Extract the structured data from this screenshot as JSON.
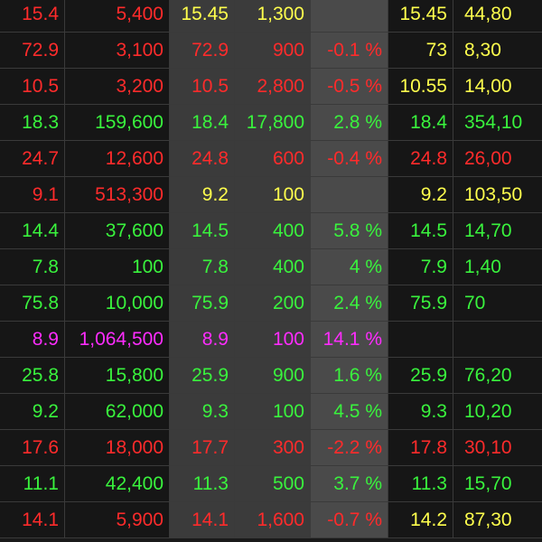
{
  "colors": {
    "down": "#ff2b2b",
    "up": "#39f33d",
    "reference": "#ffff4d",
    "ceiling": "#ff2cff",
    "dark_cell": "#161616",
    "grey_cell": "#3b3b3b",
    "light_grey_cell": "#4a4a4a"
  },
  "rows": [
    {
      "c1": "15.4",
      "c2": "5,400",
      "c3": "15.45",
      "c4": "1,300",
      "c5": "",
      "c6": "15.45",
      "c7": "44,80",
      "cls": [
        "r",
        "r",
        "y",
        "y",
        "y",
        "y",
        "y"
      ]
    },
    {
      "c1": "72.9",
      "c2": "3,100",
      "c3": "72.9",
      "c4": "900",
      "c5": "-0.1 %",
      "c6": "73",
      "c7": "8,30",
      "cls": [
        "r",
        "r",
        "r",
        "r",
        "r",
        "y",
        "y"
      ]
    },
    {
      "c1": "10.5",
      "c2": "3,200",
      "c3": "10.5",
      "c4": "2,800",
      "c5": "-0.5 %",
      "c6": "10.55",
      "c7": "14,00",
      "cls": [
        "r",
        "r",
        "r",
        "r",
        "r",
        "y",
        "y"
      ]
    },
    {
      "c1": "18.3",
      "c2": "159,600",
      "c3": "18.4",
      "c4": "17,800",
      "c5": "2.8 %",
      "c6": "18.4",
      "c7": "354,10",
      "cls": [
        "g",
        "g",
        "g",
        "g",
        "g",
        "g",
        "g"
      ]
    },
    {
      "c1": "24.7",
      "c2": "12,600",
      "c3": "24.8",
      "c4": "600",
      "c5": "-0.4 %",
      "c6": "24.8",
      "c7": "26,00",
      "cls": [
        "r",
        "r",
        "r",
        "r",
        "r",
        "r",
        "r"
      ]
    },
    {
      "c1": "9.1",
      "c2": "513,300",
      "c3": "9.2",
      "c4": "100",
      "c5": "",
      "c6": "9.2",
      "c7": "103,50",
      "cls": [
        "r",
        "r",
        "y",
        "y",
        "y",
        "y",
        "y"
      ]
    },
    {
      "c1": "14.4",
      "c2": "37,600",
      "c3": "14.5",
      "c4": "400",
      "c5": "5.8 %",
      "c6": "14.5",
      "c7": "14,70",
      "cls": [
        "g",
        "g",
        "g",
        "g",
        "g",
        "g",
        "g"
      ]
    },
    {
      "c1": "7.8",
      "c2": "100",
      "c3": "7.8",
      "c4": "400",
      "c5": "4 %",
      "c6": "7.9",
      "c7": "1,40",
      "cls": [
        "g",
        "g",
        "g",
        "g",
        "g",
        "g",
        "g"
      ]
    },
    {
      "c1": "75.8",
      "c2": "10,000",
      "c3": "75.9",
      "c4": "200",
      "c5": "2.4 %",
      "c6": "75.9",
      "c7": "70",
      "cls": [
        "g",
        "g",
        "g",
        "g",
        "g",
        "g",
        "g"
      ]
    },
    {
      "c1": "8.9",
      "c2": "1,064,500",
      "c3": "8.9",
      "c4": "100",
      "c5": "14.1 %",
      "c6": "",
      "c7": "",
      "cls": [
        "m",
        "m",
        "m",
        "m",
        "m",
        "m",
        "m"
      ]
    },
    {
      "c1": "25.8",
      "c2": "15,800",
      "c3": "25.9",
      "c4": "900",
      "c5": "1.6 %",
      "c6": "25.9",
      "c7": "76,20",
      "cls": [
        "g",
        "g",
        "g",
        "g",
        "g",
        "g",
        "g"
      ]
    },
    {
      "c1": "9.2",
      "c2": "62,000",
      "c3": "9.3",
      "c4": "100",
      "c5": "4.5 %",
      "c6": "9.3",
      "c7": "10,20",
      "cls": [
        "g",
        "g",
        "g",
        "g",
        "g",
        "g",
        "g"
      ]
    },
    {
      "c1": "17.6",
      "c2": "18,000",
      "c3": "17.7",
      "c4": "300",
      "c5": "-2.2 %",
      "c6": "17.8",
      "c7": "30,10",
      "cls": [
        "r",
        "r",
        "r",
        "r",
        "r",
        "r",
        "r"
      ]
    },
    {
      "c1": "11.1",
      "c2": "42,400",
      "c3": "11.3",
      "c4": "500",
      "c5": "3.7 %",
      "c6": "11.3",
      "c7": "15,70",
      "cls": [
        "g",
        "g",
        "g",
        "g",
        "g",
        "g",
        "g"
      ]
    },
    {
      "c1": "14.1",
      "c2": "5,900",
      "c3": "14.1",
      "c4": "1,600",
      "c5": "-0.7 %",
      "c6": "14.2",
      "c7": "87,30",
      "cls": [
        "r",
        "r",
        "r",
        "r",
        "r",
        "y",
        "y"
      ]
    }
  ]
}
